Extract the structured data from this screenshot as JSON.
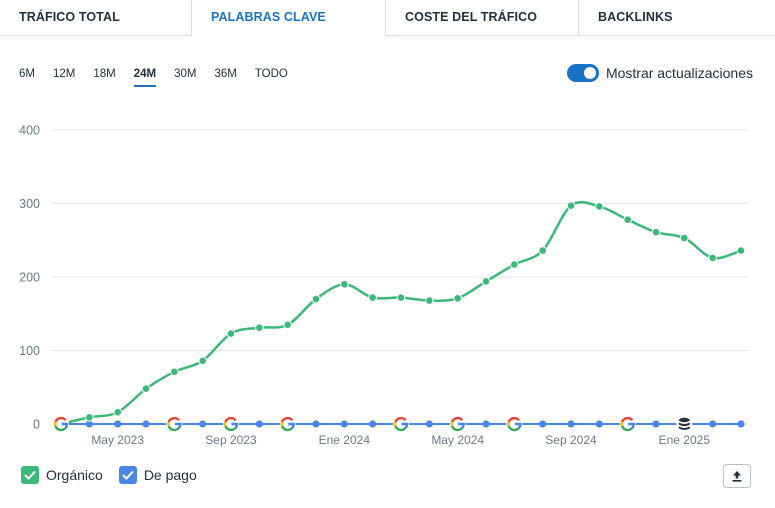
{
  "tabs": [
    {
      "label": "TRÁFICO TOTAL",
      "active": false
    },
    {
      "label": "PALABRAS CLAVE",
      "active": true
    },
    {
      "label": "COSTE DEL TRÁFICO",
      "active": false
    },
    {
      "label": "BACKLINKS",
      "active": false
    }
  ],
  "ranges": [
    "6M",
    "12M",
    "18M",
    "24M",
    "30M",
    "36M",
    "TODO"
  ],
  "active_range": "24M",
  "toggle": {
    "label": "Mostrar actualizaciones",
    "on": true
  },
  "legend": {
    "organic": "Orgánico",
    "paid": "De pago"
  },
  "colors": {
    "organic": "#3cb878",
    "paid": "#4b86e6",
    "accent": "#1a73c9",
    "grid": "#e3e7ec",
    "axis_text": "#6b7a89"
  },
  "chart_data": {
    "type": "line",
    "y_ticks": [
      "400",
      "300",
      "200",
      "100",
      "0"
    ],
    "ylim": [
      0,
      400
    ],
    "x_tick_labels": [
      "May 2023",
      "Sep 2023",
      "Ene 2024",
      "May 2024",
      "Sep 2024",
      "Ene 2025"
    ],
    "x_points": 25,
    "series": [
      {
        "name": "Orgánico",
        "values": [
          0,
          9,
          16,
          48,
          71,
          86,
          123,
          131,
          135,
          170,
          190,
          172,
          172,
          168,
          171,
          194,
          217,
          236,
          297,
          296,
          278,
          261,
          253,
          226,
          236
        ]
      },
      {
        "name": "De pago",
        "values": [
          0,
          0,
          0,
          0,
          0,
          0,
          0,
          0,
          0,
          0,
          0,
          0,
          0,
          0,
          0,
          0,
          0,
          0,
          0,
          0,
          0,
          0,
          0,
          0,
          0
        ]
      }
    ],
    "update_markers": [
      {
        "index": 0,
        "icon": "google-icon"
      },
      {
        "index": 4,
        "icon": "google-icon"
      },
      {
        "index": 6,
        "icon": "google-icon"
      },
      {
        "index": 8,
        "icon": "google-icon"
      },
      {
        "index": 12,
        "icon": "google-icon"
      },
      {
        "index": 14,
        "icon": "google-icon"
      },
      {
        "index": 16,
        "icon": "google-icon"
      },
      {
        "index": 20,
        "icon": "google-icon"
      },
      {
        "index": 22,
        "icon": "database-icon"
      }
    ],
    "grid": true
  }
}
